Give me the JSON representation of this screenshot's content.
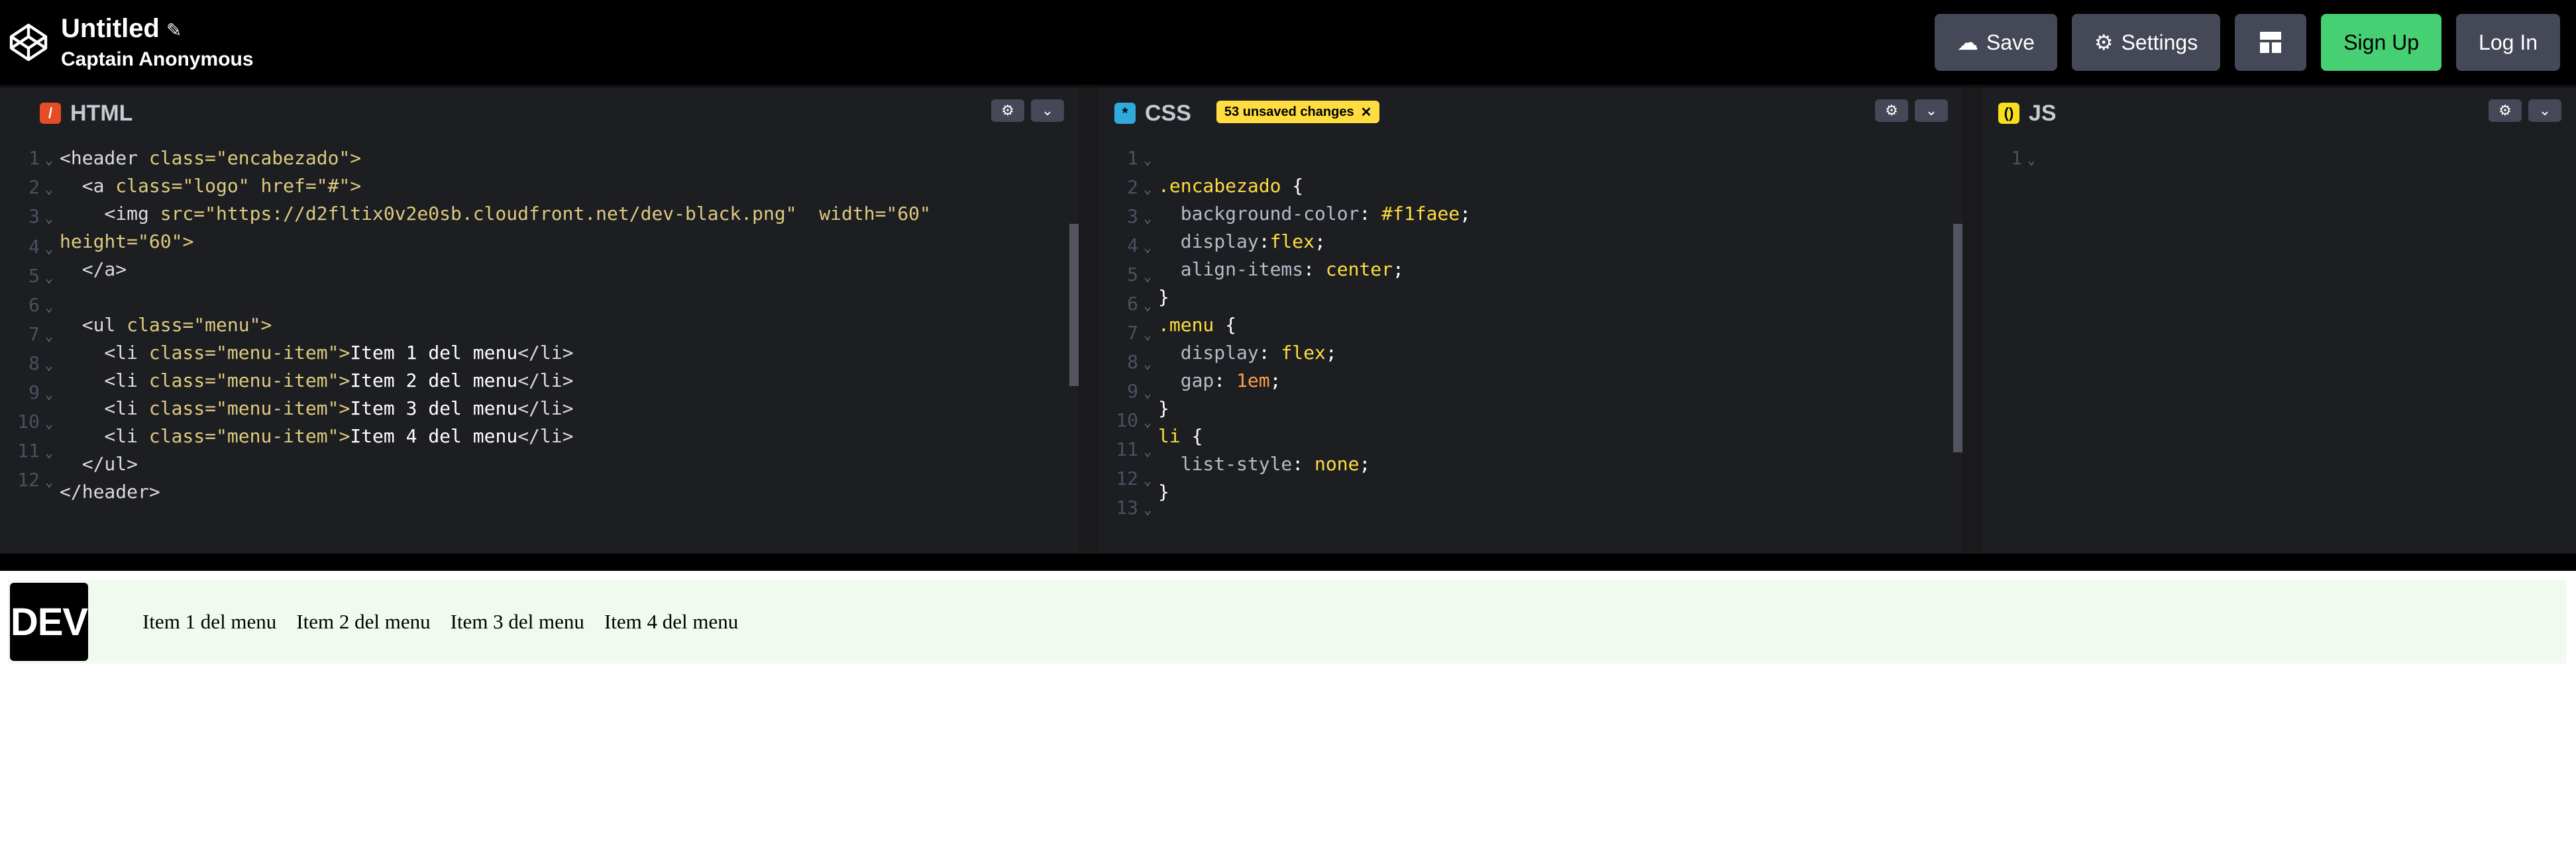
{
  "app": {
    "title": "Untitled",
    "user": "Captain Anonymous"
  },
  "actions": {
    "save": "Save",
    "settings": "Settings",
    "signup": "Sign Up",
    "login": "Log In"
  },
  "html_editor": {
    "tab": "HTML",
    "lines": [
      [
        {
          "t": "<header ",
          "c": "c-tag"
        },
        {
          "t": "class",
          "c": "c-attr"
        },
        {
          "t": "=\"encabezado\">",
          "c": "c-str"
        }
      ],
      [
        {
          "t": "  <a ",
          "c": "c-tag"
        },
        {
          "t": "class",
          "c": "c-attr"
        },
        {
          "t": "=\"logo\" ",
          "c": "c-str"
        },
        {
          "t": "href",
          "c": "c-attr"
        },
        {
          "t": "=\"#\">",
          "c": "c-str"
        }
      ],
      [
        {
          "t": "    <img ",
          "c": "c-tag"
        },
        {
          "t": "src",
          "c": "c-attr"
        },
        {
          "t": "=\"https://d2fltix0v2e0sb.cloudfront.net/dev-black.png\"  ",
          "c": "c-str"
        },
        {
          "t": "width",
          "c": "c-attr"
        },
        {
          "t": "=\"60\"",
          "c": "c-str"
        }
      ],
      [
        {
          "t": "height",
          "c": "c-attr"
        },
        {
          "t": "=\"60\">",
          "c": "c-str"
        }
      ],
      [
        {
          "t": "  </a>",
          "c": "c-tag"
        }
      ],
      [
        {
          "t": "",
          "c": "c-text"
        }
      ],
      [
        {
          "t": "  <ul ",
          "c": "c-tag"
        },
        {
          "t": "class",
          "c": "c-attr"
        },
        {
          "t": "=\"menu\">",
          "c": "c-str"
        }
      ],
      [
        {
          "t": "    <li ",
          "c": "c-tag"
        },
        {
          "t": "class",
          "c": "c-attr"
        },
        {
          "t": "=\"menu-item\">",
          "c": "c-str"
        },
        {
          "t": "Item 1 del menu",
          "c": "c-text"
        },
        {
          "t": "</li>",
          "c": "c-tag"
        }
      ],
      [
        {
          "t": "    <li ",
          "c": "c-tag"
        },
        {
          "t": "class",
          "c": "c-attr"
        },
        {
          "t": "=\"menu-item\">",
          "c": "c-str"
        },
        {
          "t": "Item 2 del menu",
          "c": "c-text"
        },
        {
          "t": "</li>",
          "c": "c-tag"
        }
      ],
      [
        {
          "t": "    <li ",
          "c": "c-tag"
        },
        {
          "t": "class",
          "c": "c-attr"
        },
        {
          "t": "=\"menu-item\">",
          "c": "c-str"
        },
        {
          "t": "Item 3 del menu",
          "c": "c-text"
        },
        {
          "t": "</li>",
          "c": "c-tag"
        }
      ],
      [
        {
          "t": "    <li ",
          "c": "c-tag"
        },
        {
          "t": "class",
          "c": "c-attr"
        },
        {
          "t": "=\"menu-item\">",
          "c": "c-str"
        },
        {
          "t": "Item 4 del menu",
          "c": "c-text"
        },
        {
          "t": "</li>",
          "c": "c-tag"
        }
      ],
      [
        {
          "t": "  </ul>",
          "c": "c-tag"
        }
      ],
      [
        {
          "t": "</header>",
          "c": "c-tag"
        }
      ]
    ],
    "gutter": [
      "1",
      "2",
      "3",
      "",
      "4",
      "5",
      "6",
      "7",
      "8",
      "9",
      "10",
      "11",
      "12"
    ]
  },
  "css_editor": {
    "tab": "CSS",
    "unsaved": "53 unsaved changes",
    "lines": [
      [
        {
          "t": "",
          "c": "c-text"
        }
      ],
      [
        {
          "t": ".encabezado ",
          "c": "c-sel"
        },
        {
          "t": "{",
          "c": "c-text"
        }
      ],
      [
        {
          "t": "  background-color",
          "c": "c-prop"
        },
        {
          "t": ": ",
          "c": "c-text"
        },
        {
          "t": "#f1faee",
          "c": "c-kw"
        },
        {
          "t": ";",
          "c": "c-text"
        }
      ],
      [
        {
          "t": "  display",
          "c": "c-prop"
        },
        {
          "t": ":",
          "c": "c-text"
        },
        {
          "t": "flex",
          "c": "c-kw"
        },
        {
          "t": ";",
          "c": "c-text"
        }
      ],
      [
        {
          "t": "  align-items",
          "c": "c-prop"
        },
        {
          "t": ": ",
          "c": "c-text"
        },
        {
          "t": "center",
          "c": "c-kw"
        },
        {
          "t": ";",
          "c": "c-text"
        }
      ],
      [
        {
          "t": "}",
          "c": "c-text"
        }
      ],
      [
        {
          "t": ".menu ",
          "c": "c-sel"
        },
        {
          "t": "{",
          "c": "c-text"
        }
      ],
      [
        {
          "t": "  display",
          "c": "c-prop"
        },
        {
          "t": ": ",
          "c": "c-text"
        },
        {
          "t": "flex",
          "c": "c-kw"
        },
        {
          "t": ";",
          "c": "c-text"
        }
      ],
      [
        {
          "t": "  gap",
          "c": "c-prop"
        },
        {
          "t": ": ",
          "c": "c-text"
        },
        {
          "t": "1em",
          "c": "c-num"
        },
        {
          "t": ";",
          "c": "c-text"
        }
      ],
      [
        {
          "t": "}",
          "c": "c-text"
        }
      ],
      [
        {
          "t": "li ",
          "c": "c-sel"
        },
        {
          "t": "{",
          "c": "c-text"
        }
      ],
      [
        {
          "t": "  list-style",
          "c": "c-prop"
        },
        {
          "t": ": ",
          "c": "c-text"
        },
        {
          "t": "none",
          "c": "c-kw"
        },
        {
          "t": ";",
          "c": "c-text"
        }
      ],
      [
        {
          "t": "}",
          "c": "c-text"
        }
      ]
    ],
    "gutter": [
      "1",
      "2",
      "3",
      "4",
      "5",
      "6",
      "7",
      "8",
      "9",
      "10",
      "11",
      "12",
      "13"
    ]
  },
  "js_editor": {
    "tab": "JS",
    "gutter": [
      "1"
    ]
  },
  "preview": {
    "logo_text": "DEV",
    "menu_items": [
      "Item 1 del menu",
      "Item 2 del menu",
      "Item 3 del menu",
      "Item 4 del menu"
    ]
  }
}
